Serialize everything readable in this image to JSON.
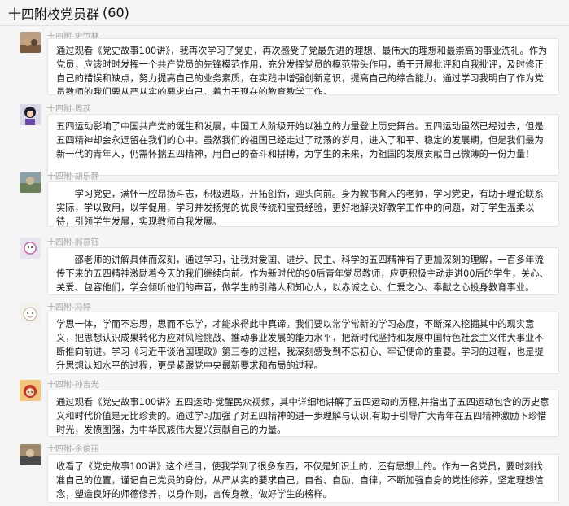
{
  "window": {
    "title": "十四附校党员群",
    "member_count": "(60)"
  },
  "messages": [
    {
      "sender": "十四附-史竹林",
      "text": "通过观看《党史故事100讲》，我再次学习了党史，再次感受了党最先进的理想、最伟大的理想和最崇高的事业洗礼。作为党员，应该时时发挥一个共产党员的先锋模范作用，充分发挥党员的模范带头作用，勇于开展批评和自我批评，及时修正自己的错误和缺点，努力提高自己的业务素质，在实践中增强创新意识，提高自己的综合能力。通过学习我明白了作为党员教师的我们要从严从实的要求自己，着力于现在的教育教学工作。",
      "avatar_colors": [
        "#7a5a3c",
        "#c9a27a"
      ]
    },
    {
      "sender": "十四附-周荻",
      "text": "五四运动影响了中国共产党的诞生和发展，中国工人阶级开始以独立的力量登上历史舞台。五四运动虽然已经过去，但是五四精神却会永远留在我们的心中。虽然我们的祖国已经走过了动荡的岁月，进入了和平、稳定的发展期，但是我们最为新一代的青年人，仍需怀揣五四精神，用自己的奋斗和拼搏，为学生的未来，为祖国的发展贡献自己微薄的一份力量！",
      "avatar_colors": [
        "#1b1b2a",
        "#6a4aa8"
      ]
    },
    {
      "sender": "十四附-胡乐静",
      "text": "　　学习党史，满怀一腔昂扬斗志，积极进取，开拓创新，迎头向前。身为教书育人的老师，学习党史，有助于理论联系实际，学以致用，以学促用，学习并发扬党的优良传统和宝贵经验，更好地解决好教学工作中的问题，对于学生温柔以待，引领学生发展，实现教师自我发展。",
      "avatar_colors": [
        "#6b7f5a",
        "#c8b99a"
      ]
    },
    {
      "sender": "十四附-郝意钰",
      "text": "　　邵老师的讲解具体而深刻，通过学习，让我对爱国、进步、民主、科学的五四精神有了更加深刻的理解，一百多年流传下来的五四精神激励着今天的我们继续向前。作为新时代的90后青年党员教师，应更积极主动走进00后的学生，关心、关爱、包容他们，学会倾听他们的声音，做学生的引路人和知心人，以赤诚之心、仁爱之心、奉献之心投身教育事业。",
      "avatar_colors": [
        "#e9e4ef",
        "#c06aa8"
      ]
    },
    {
      "sender": "十四附-冯婷",
      "text": "学思一体，学而不忘思，思而不忘学，才能求得此中真谛。我们要以常学常新的学习态度，不断深入挖掘其中的现实意义，把思想认识成果转化为应对风险挑战、推动事业发展的能力水平，把新时代坚持和发展中国特色社会主义伟大事业不断推向前进。学习《习近平谈治国理政》第三卷的过程，我深刻感受到不忘初心、牢记使命的重要。学习的过程，也是提升思想认知水平的过程，更是紧跟党中央最新要求和布局的过程。",
      "avatar_colors": [
        "#f4f0ec",
        "#b6a89a"
      ]
    },
    {
      "sender": "十四附-孙吉光",
      "text": "通过观看《党史故事100讲》五四运动-觉醒民众视频，其中详细地讲解了五四运动的历程,并指出了五四运动包含的历史意义和时代价值是无比珍贵的。通过学习加强了对五四精神的进一步理解与认识,有助于引导广大青年在五四精神激励下珍惜时光，发愤图强，为中华民族伟大复兴贡献自己的力量。",
      "avatar_colors": [
        "#c0392b",
        "#f2c57c"
      ]
    },
    {
      "sender": "十四附-余俊丽",
      "text": "收看了《党史故事100讲》这个栏目，使我学到了很多东西，不仅是知识上的，还有思想上的。作为一名党员，要时刻找准自己的位置，谨记自己党员的身份，从严从实的要求自己，自省、自励、自律，不断加强自身的党性修养，坚定理想信念，塑造良好的师德修养，以身作则，言传身教，做好学生的榜样。",
      "avatar_colors": [
        "#4a4a4a",
        "#a08a6e"
      ]
    }
  ]
}
